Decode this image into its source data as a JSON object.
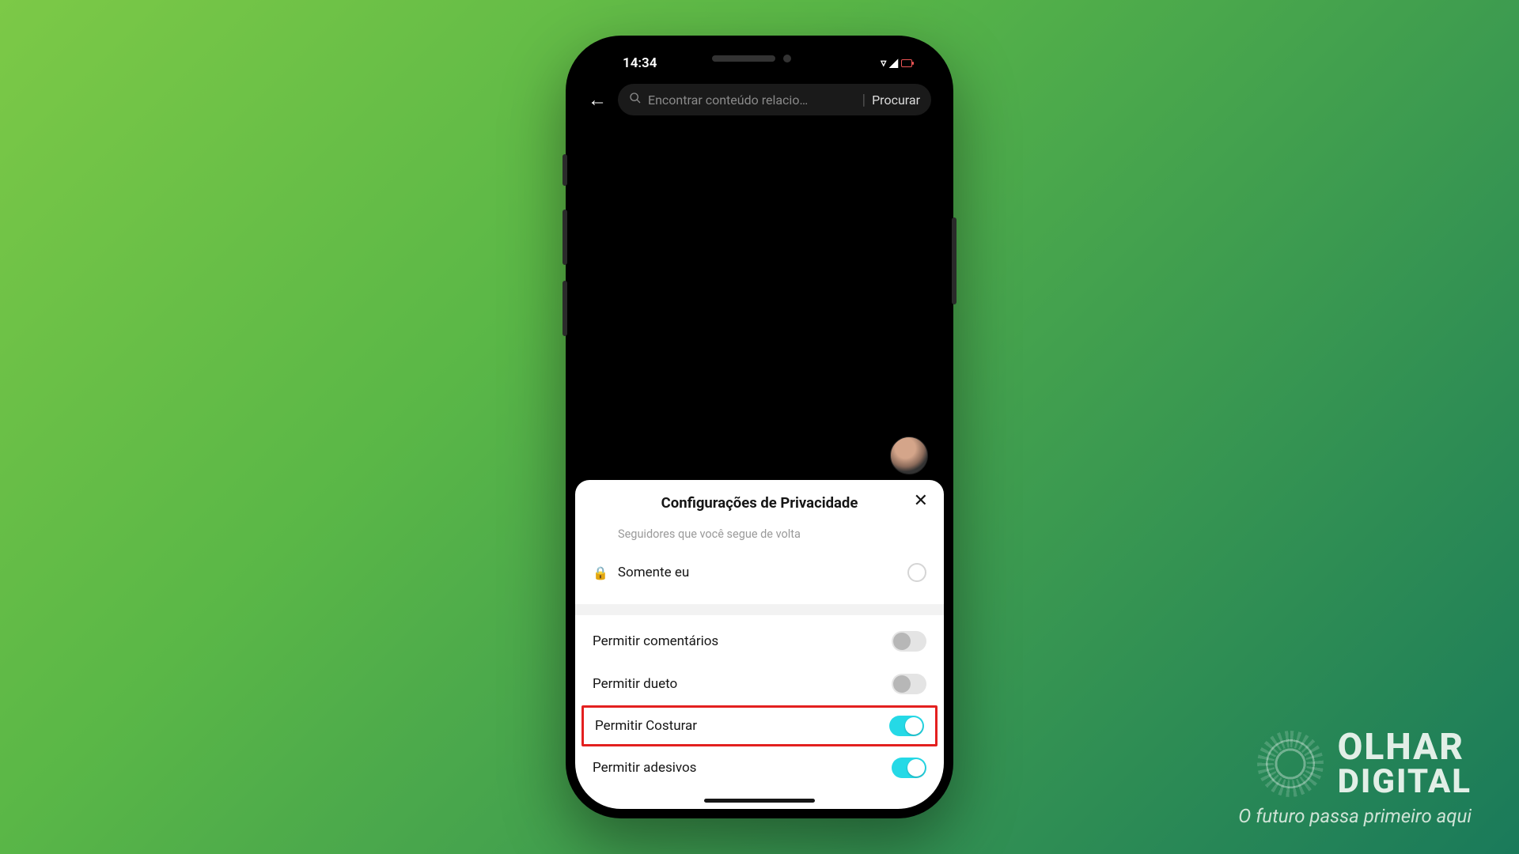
{
  "statusbar": {
    "time": "14:34"
  },
  "search": {
    "placeholder": "Encontrar conteúdo relacio…",
    "action_label": "Procurar"
  },
  "sheet": {
    "title": "Configurações de Privacidade",
    "subtext": "Seguidores que você segue de volta",
    "option_only_me": "Somente eu"
  },
  "toggles": {
    "comments": {
      "label": "Permitir comentários",
      "on": false
    },
    "duet": {
      "label": "Permitir dueto",
      "on": false
    },
    "stitch": {
      "label": "Permitir Costurar",
      "on": true
    },
    "stickers": {
      "label": "Permitir adesivos",
      "on": true
    }
  },
  "brand": {
    "line1": "OLHAR",
    "line2": "DIGITAL",
    "tagline": "O futuro passa primeiro aqui"
  }
}
